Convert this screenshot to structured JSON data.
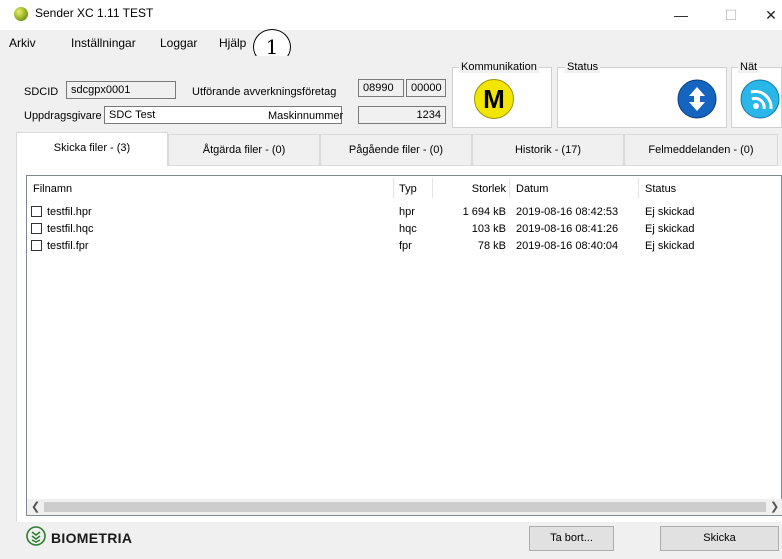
{
  "window": {
    "title": "Sender XC 1.11   TEST"
  },
  "menu": {
    "items": [
      "Arkiv",
      "Inställningar",
      "Loggar",
      "Hjälp"
    ],
    "callout": "1"
  },
  "form": {
    "sdcid_label": "SDCID",
    "sdcid_value": "sdcgpx0001",
    "uppdragsgivare_label": "Uppdragsgivare",
    "uppdragsgivare_value": "SDC Test",
    "foretag_label": "Utförande avverkningsföretag",
    "foretag_value1": "08990",
    "foretag_value2": "00000",
    "maskin_label": "Maskinnummer",
    "maskin_value": "1234"
  },
  "panels": {
    "kommunikation_label": "Kommunikation",
    "kommunikation_badge": "M",
    "status_label": "Status",
    "nat_label": "Nät"
  },
  "tabs": [
    "Skicka filer - (3)",
    "Åtgärda filer - (0)",
    "Pågående filer - (0)",
    "Historik - (17)",
    "Felmeddelanden - (0)"
  ],
  "table": {
    "headers": {
      "name": "Filnamn",
      "type": "Typ",
      "size": "Storlek",
      "date": "Datum",
      "status": "Status"
    },
    "rows": [
      {
        "name": "testfil.hpr",
        "type": "hpr",
        "size": "1 694 kB",
        "date": "2019-08-16 08:42:53",
        "status": "Ej skickad"
      },
      {
        "name": "testfil.hqc",
        "type": "hqc",
        "size": "103 kB",
        "date": "2019-08-16 08:41:26",
        "status": "Ej skickad"
      },
      {
        "name": "testfil.fpr",
        "type": "fpr",
        "size": "78 kB",
        "date": "2019-08-16 08:40:04",
        "status": "Ej skickad"
      }
    ]
  },
  "footer": {
    "brand": "BIOMETRIA",
    "remove_button": "Ta bort...",
    "send_button": "Skicka"
  },
  "colors": {
    "accent_blue": "#1565c0",
    "badge_yellow": "#f2e600",
    "net_cyan": "#29b6e8",
    "brand_green": "#2e7d32"
  }
}
